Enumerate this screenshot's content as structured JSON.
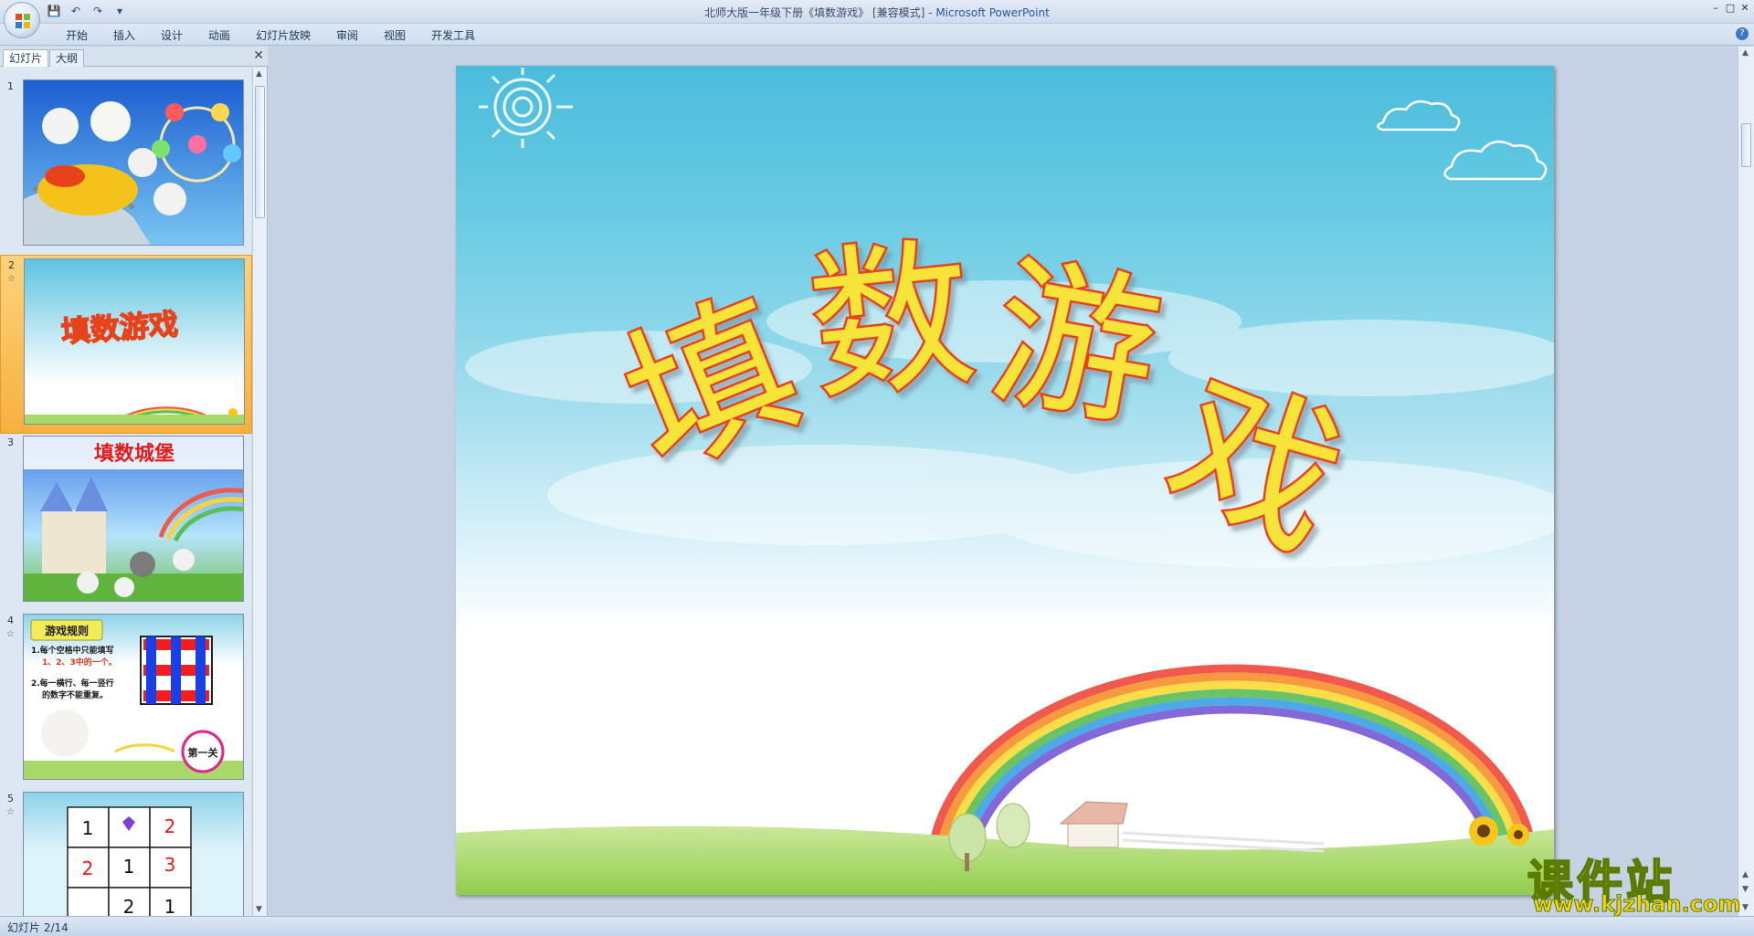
{
  "window": {
    "title": "北师大版一年级下册《填数游戏》 [兼容模式] - ",
    "app_name": "Microsoft PowerPoint"
  },
  "ribbon": {
    "tabs": [
      "开始",
      "插入",
      "设计",
      "动画",
      "幻灯片放映",
      "审阅",
      "视图",
      "开发工具"
    ]
  },
  "left_pane": {
    "tab_slides": "幻灯片",
    "tab_outline": "大纲",
    "slides": [
      {
        "number": "1"
      },
      {
        "number": "2",
        "text": "填数游戏"
      },
      {
        "number": "3",
        "text": "填数城堡"
      },
      {
        "number": "4",
        "rules_title": "游戏规则",
        "rule1_a": "1.每个空格中只能填写",
        "rule1_b": "1、2、3中的一个。",
        "rule2_a": "2.每一横行、每一竖行",
        "rule2_b": "的数字不能重复。",
        "badge": "第一关"
      },
      {
        "number": "5",
        "grid": [
          "1",
          "",
          "2",
          "2",
          "1",
          "3",
          "",
          "2",
          "1"
        ]
      }
    ]
  },
  "main_slide": {
    "title": "填数游戏"
  },
  "status": {
    "slide_indicator": "幻灯片 2/14"
  },
  "watermark": {
    "main": "课件站",
    "url": "www.kjzhan.com"
  },
  "colors": {
    "accent_title_fill": "#f7e43a",
    "accent_title_stroke": "#e8421a",
    "sky_top": "#5dc3e0",
    "selected_thumb": "#f7b03e"
  }
}
